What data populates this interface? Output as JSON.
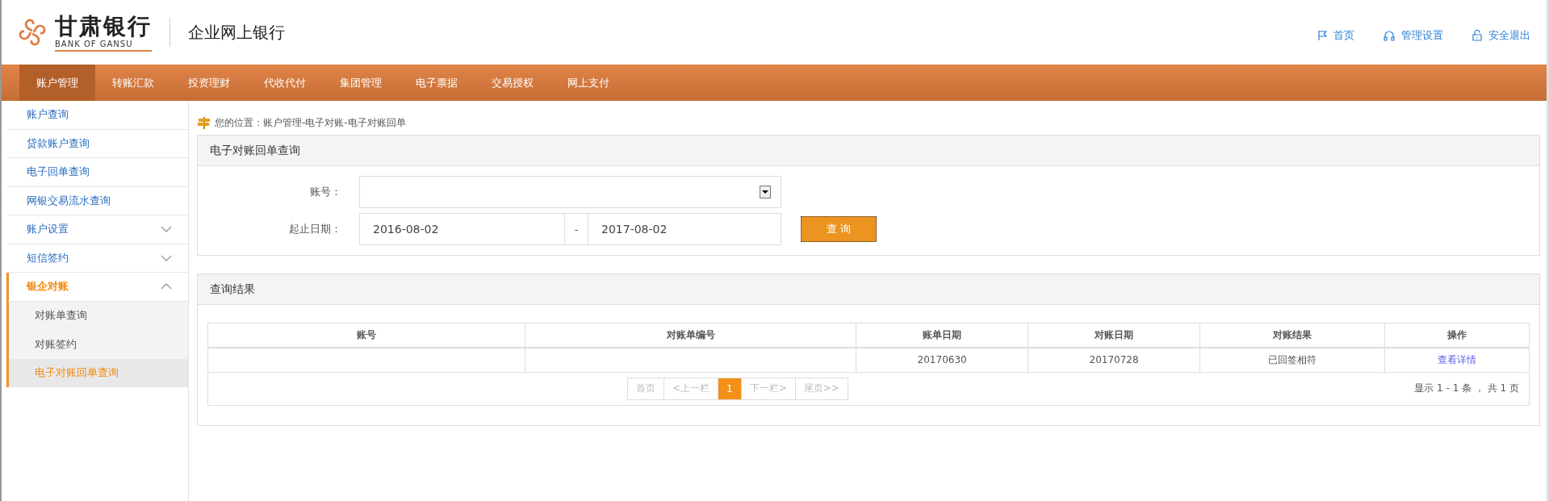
{
  "header": {
    "logo_name": "甘肃银行",
    "logo_en": "BANK OF GANSU",
    "site_title": "企业网上银行",
    "links": [
      {
        "kind": "home",
        "label": "首页"
      },
      {
        "kind": "support",
        "label": "管理设置"
      },
      {
        "kind": "logout",
        "label": "安全退出"
      }
    ]
  },
  "nav": [
    {
      "label": "账户管理",
      "selected": true
    },
    {
      "label": "转账汇款",
      "selected": false
    },
    {
      "label": "投资理财",
      "selected": false
    },
    {
      "label": "代收代付",
      "selected": false
    },
    {
      "label": "集团管理",
      "selected": false
    },
    {
      "label": "电子票据",
      "selected": false
    },
    {
      "label": "交易授权",
      "selected": false
    },
    {
      "label": "网上支付",
      "selected": false
    }
  ],
  "sidebar": [
    {
      "kind": "link",
      "label": "账户查询",
      "selected": false
    },
    {
      "kind": "link",
      "label": "贷款账户查询",
      "selected": false
    },
    {
      "kind": "link",
      "label": "电子回单查询",
      "selected": false
    },
    {
      "kind": "link",
      "label": "网银交易流水查询",
      "selected": false
    },
    {
      "kind": "group",
      "label": "账户设置",
      "selected": false,
      "expanded": false
    },
    {
      "kind": "group",
      "label": "短信签约",
      "selected": false,
      "expanded": false
    },
    {
      "kind": "group",
      "label": "银企对账",
      "selected": true,
      "expanded": true,
      "children": [
        {
          "label": "对账单查询",
          "selected": false
        },
        {
          "label": "对账签约",
          "selected": false
        },
        {
          "label": "电子对账回单查询",
          "selected": true
        }
      ]
    }
  ],
  "breadcrumb": "您的位置：账户管理-电子对账-电子对账回单",
  "query_panel": {
    "title": "电子对账回单查询",
    "account_label": "账号：",
    "date_label": "起止日期：",
    "start_date": "2016-08-02",
    "separator": "-",
    "end_date": "2017-08-02",
    "button": "查 询"
  },
  "results_panel": {
    "title": "查询结果",
    "table": {
      "columns": [
        "账号",
        "对账单编号",
        "账单日期",
        "对账日期",
        "对账结果",
        "操作"
      ],
      "rows": [
        {
          "bill_date": "20170630",
          "check_date": "20170728",
          "result": "已回签相符",
          "action": "查看详情"
        }
      ]
    },
    "pagination": {
      "pages": [
        {
          "label": "首页",
          "selected": false
        },
        {
          "label": "<上一栏",
          "selected": false
        },
        {
          "label": "1",
          "selected": true
        },
        {
          "label": "下一栏>",
          "selected": false
        },
        {
          "label": "尾页>>",
          "selected": false
        }
      ],
      "summary": "显示 1 - 1 条 ， 共 1 页"
    }
  }
}
